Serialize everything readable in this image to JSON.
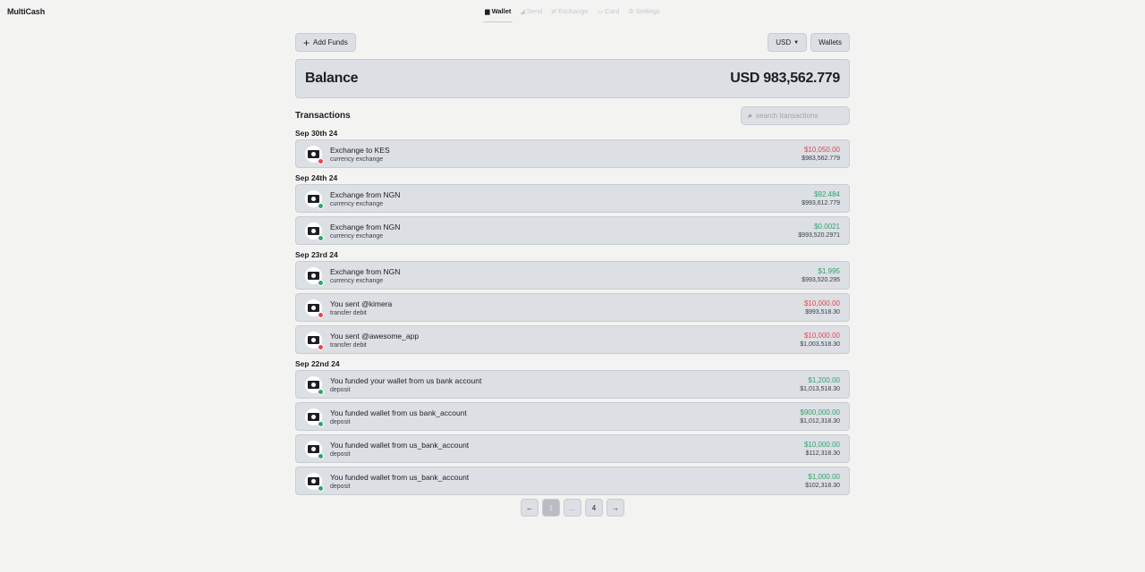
{
  "app": {
    "brand": "MultiCash"
  },
  "nav": [
    {
      "icon": "wallet-icon",
      "glyph": "▆",
      "label": "Wallet",
      "active": true
    },
    {
      "icon": "send-icon",
      "glyph": "◢",
      "label": "Send",
      "active": false
    },
    {
      "icon": "exchange-icon",
      "glyph": "⇄",
      "label": "Exchange",
      "active": false
    },
    {
      "icon": "card-icon",
      "glyph": "▭",
      "label": "Card",
      "active": false
    },
    {
      "icon": "settings-icon",
      "glyph": "⚙",
      "label": "Settings",
      "active": false
    }
  ],
  "toolbar": {
    "add_funds": "Add Funds",
    "currency": "USD",
    "wallets": "Wallets"
  },
  "balance": {
    "label": "Balance",
    "amount": "USD 983,562.779"
  },
  "transactions": {
    "title": "Transactions",
    "search_placeholder": "search transactions",
    "groups": [
      {
        "date": "Sep 30th 24",
        "items": [
          {
            "title": "Exchange to KES",
            "sub": "currency exchange",
            "amount": "$10,050.00",
            "balance": "$983,562.779",
            "direction": "out"
          }
        ]
      },
      {
        "date": "Sep 24th 24",
        "items": [
          {
            "title": "Exchange from NGN",
            "sub": "currency exchange",
            "amount": "$92.484",
            "balance": "$993,612.779",
            "direction": "in"
          },
          {
            "title": "Exchange from NGN",
            "sub": "currency exchange",
            "amount": "$0.0021",
            "balance": "$993,520.2971",
            "direction": "in"
          }
        ]
      },
      {
        "date": "Sep 23rd 24",
        "items": [
          {
            "title": "Exchange from NGN",
            "sub": "currency exchange",
            "amount": "$1.995",
            "balance": "$993,520.295",
            "direction": "in"
          },
          {
            "title": "You sent @kimera",
            "sub": "transfer debit",
            "amount": "$10,000.00",
            "balance": "$993,518.30",
            "direction": "out"
          },
          {
            "title": "You sent @awesome_app",
            "sub": "transfer debit",
            "amount": "$10,000.00",
            "balance": "$1,003,518.30",
            "direction": "out"
          }
        ]
      },
      {
        "date": "Sep 22nd 24",
        "items": [
          {
            "title": "You funded your wallet from us bank account",
            "sub": "deposit",
            "amount": "$1,200.00",
            "balance": "$1,013,518.30",
            "direction": "in"
          },
          {
            "title": "You funded wallet from us bank_account",
            "sub": "deposit",
            "amount": "$900,000.00",
            "balance": "$1,012,318.30",
            "direction": "in"
          },
          {
            "title": "You funded wallet from us_bank_account",
            "sub": "deposit",
            "amount": "$10,000.00",
            "balance": "$112,318.30",
            "direction": "in"
          },
          {
            "title": "You funded wallet from us_bank_account",
            "sub": "deposit",
            "amount": "$1,000.00",
            "balance": "$102,318.30",
            "direction": "in"
          }
        ]
      }
    ]
  },
  "pagination": {
    "prev": "←",
    "pages": [
      "1",
      "...",
      "4"
    ],
    "current": "1",
    "next": "→"
  },
  "colors": {
    "background": "#f3f3f2",
    "panel": "#dcdfe4",
    "negative": "#e5484d",
    "positive": "#30a46c"
  }
}
